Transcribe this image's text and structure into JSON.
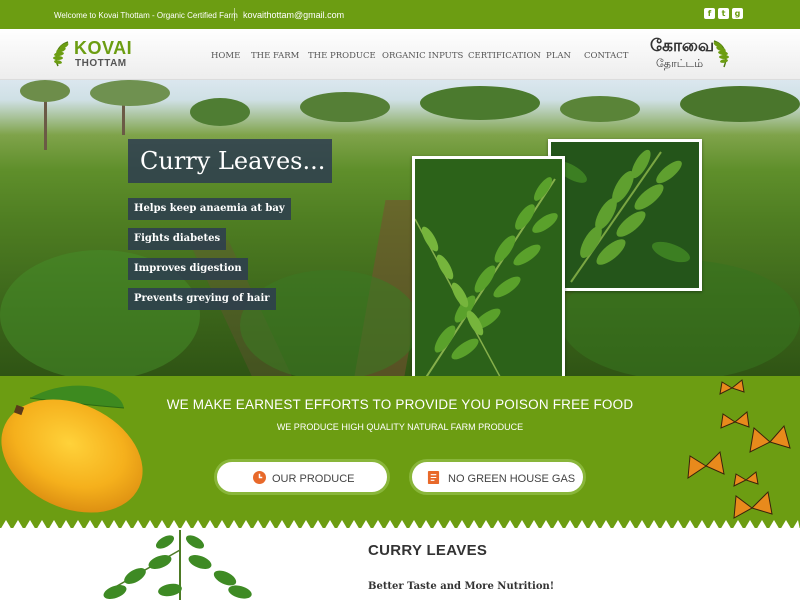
{
  "topbar": {
    "welcome": "Welcome to Kovai Thottam - Organic Certified Farm",
    "email": "kovaithottam@gmail.com",
    "social": [
      {
        "icon": "facebook-icon",
        "glyph": "f"
      },
      {
        "icon": "twitter-icon",
        "glyph": "t"
      },
      {
        "icon": "google-plus-icon",
        "glyph": "g"
      }
    ]
  },
  "header": {
    "logo_line1": "KOVAI",
    "logo_line2": "THOTTAM",
    "tamil_line1": "கோவை",
    "tamil_line2": "தோட்டம்",
    "nav": [
      "HOME",
      "THE FARM",
      "THE PRODUCE",
      "ORGANIC INPUTS",
      "CERTIFICATION",
      "PLAN",
      "CONTACT"
    ]
  },
  "hero": {
    "title": "Curry Leaves...",
    "benefits": [
      "Helps keep anaemia at bay",
      "Fights diabetes",
      "Improves digestion",
      "Prevents greying of hair"
    ]
  },
  "band": {
    "headline": "WE MAKE EARNEST EFFORTS TO PROVIDE YOU POISON FREE FOOD",
    "subheadline": "WE PRODUCE HIGH QUALITY NATURAL FARM PRODUCE",
    "buttons": [
      {
        "label": "OUR PRODUCE",
        "icon": "clock-icon"
      },
      {
        "label": "NO GREEN HOUSE GAS",
        "icon": "document-icon"
      }
    ]
  },
  "bottom": {
    "title": "CURRY LEAVES",
    "subtitle": "Better Taste and More Nutrition!"
  },
  "colors": {
    "brand_green": "#6c9d12",
    "caption_bg": "#2d3c50",
    "accent_orange": "#e8692a"
  }
}
